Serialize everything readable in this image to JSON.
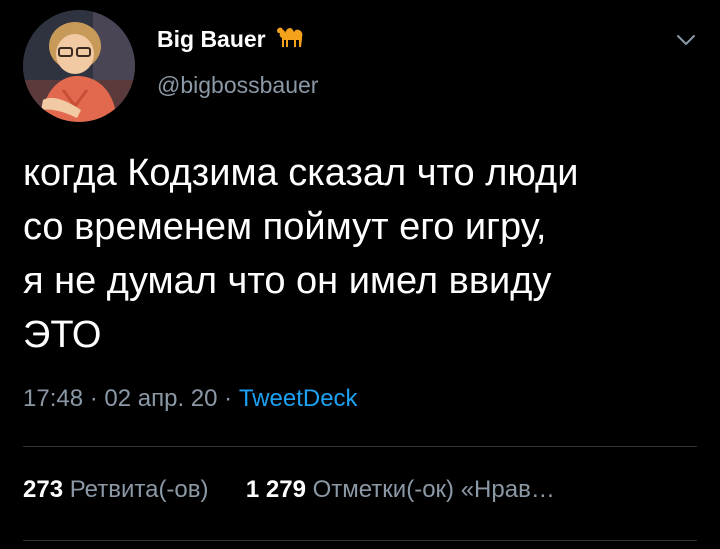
{
  "author": {
    "display_name": "Big Bauer",
    "handle": "@bigbossbauer",
    "name_emoji_icon": "camel-icon"
  },
  "tweet": {
    "lines": [
      "когда Кодзима сказал что люди",
      "со временем поймут его игру,",
      "я не думал что он имел ввиду",
      "ЭТО"
    ],
    "time": "17:48",
    "date": "02 апр. 20",
    "separator": "·",
    "source": "TweetDeck"
  },
  "stats": {
    "retweets_count": "273",
    "retweets_label": "Ретвита(-ов)",
    "likes_count": "1 279",
    "likes_label": "Отметки(-ок) «Нрав…"
  },
  "colors": {
    "background": "#000000",
    "text_primary": "#ffffff",
    "text_secondary": "#8b98a5",
    "accent": "#1da1f2",
    "divider": "#2f3336",
    "camel": "#f4a11c"
  },
  "icons": {
    "menu": "chevron-down-icon",
    "avatar": "avatar"
  }
}
